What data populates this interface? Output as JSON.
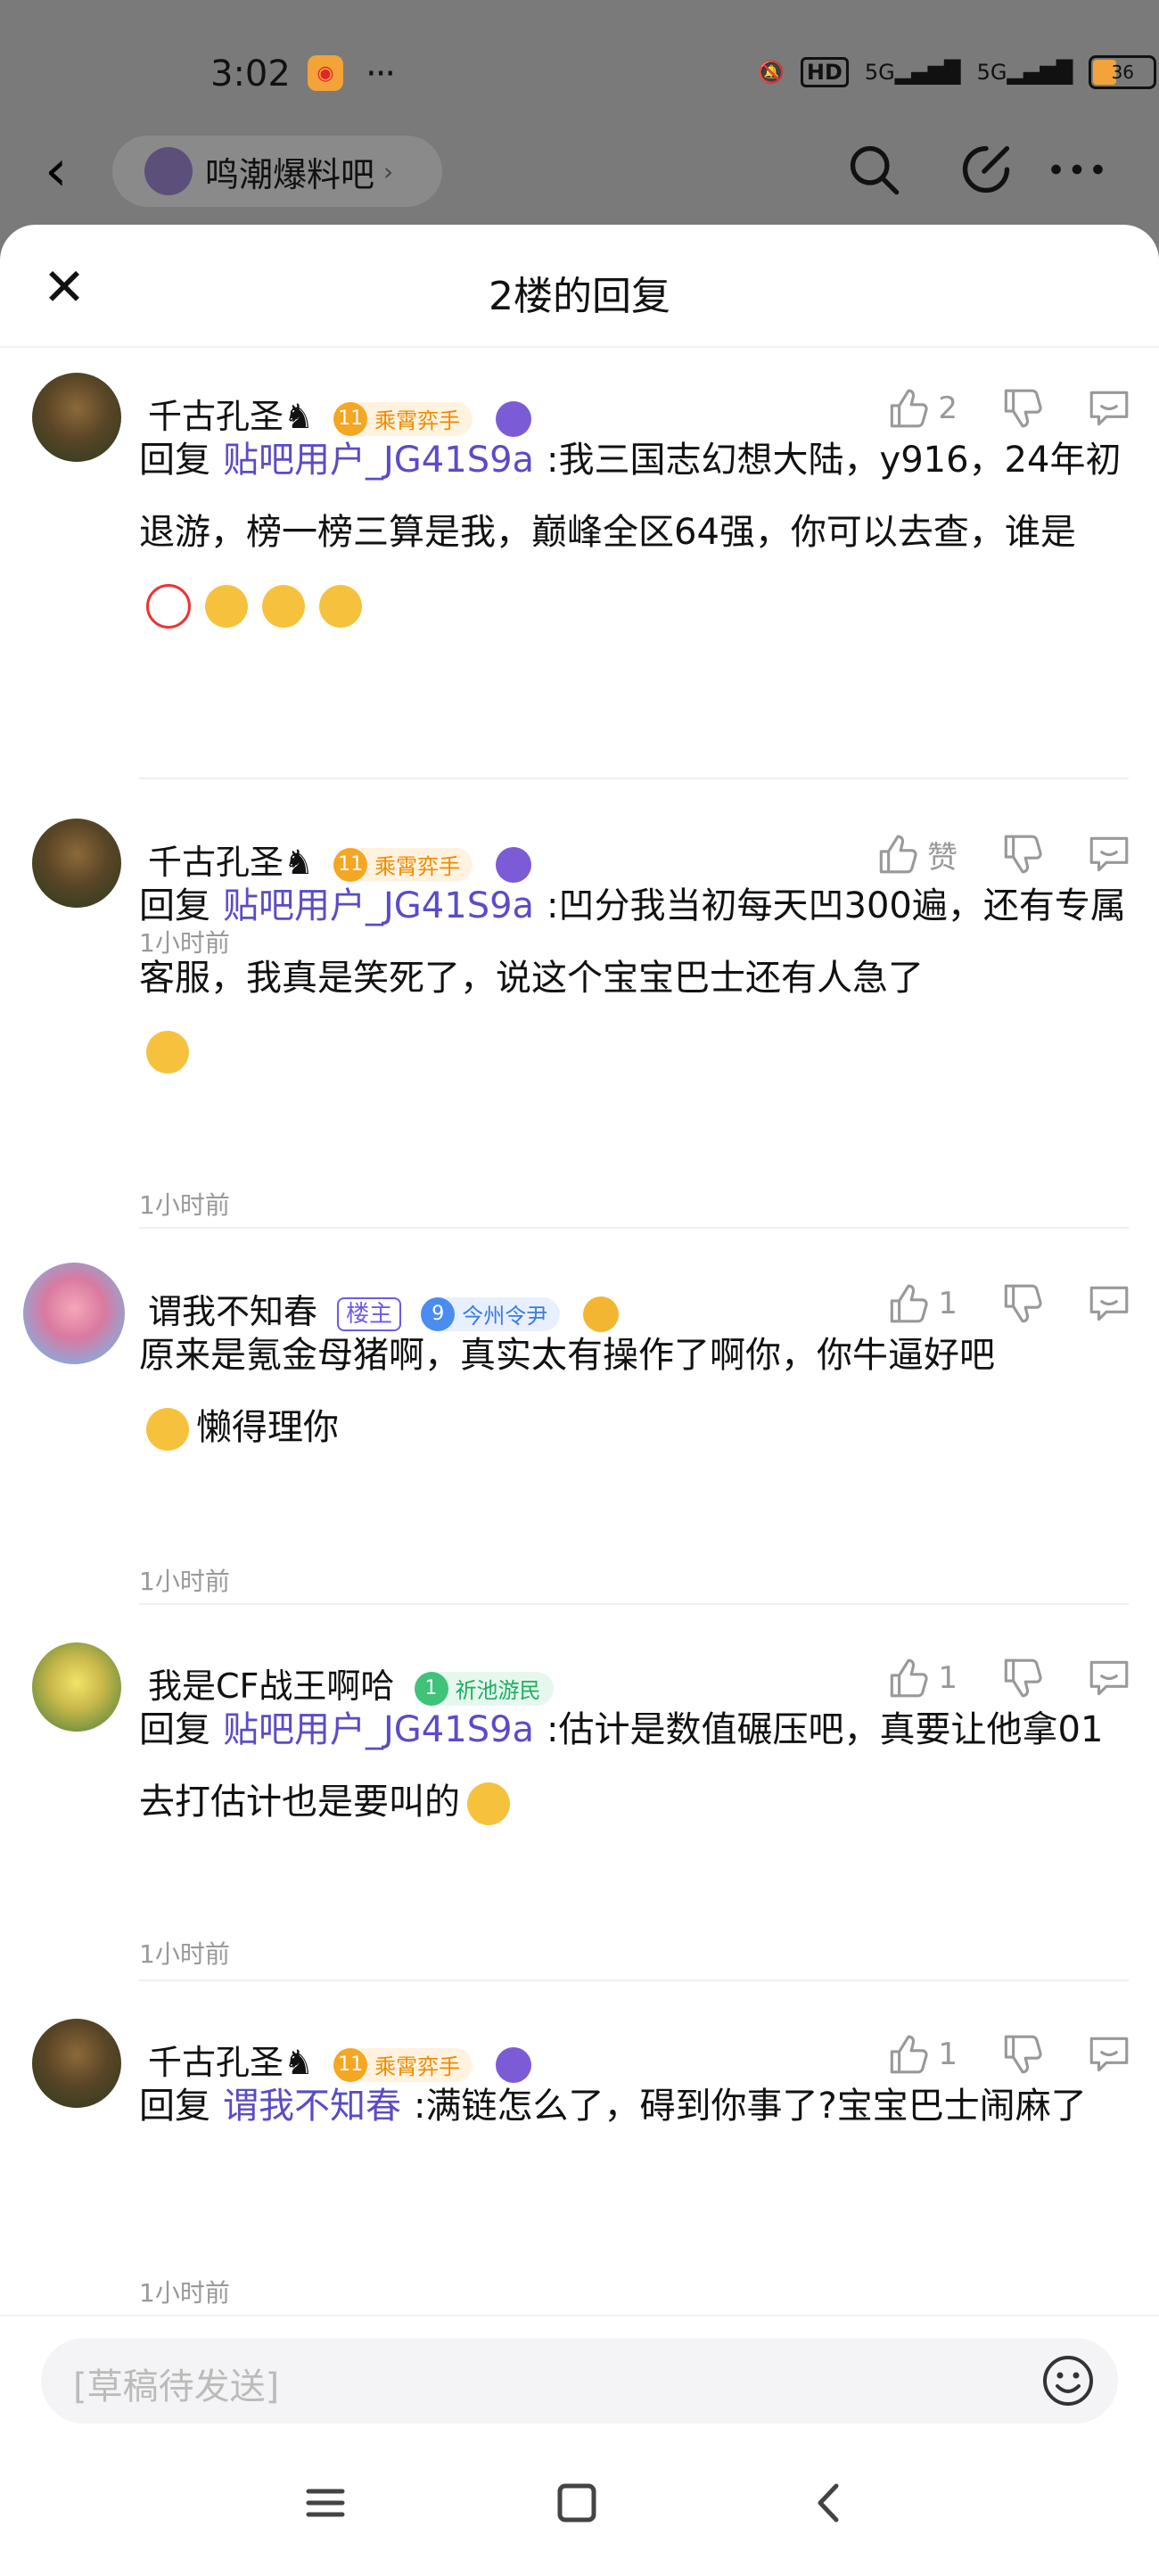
{
  "status": {
    "time": "3:02",
    "dots": "···",
    "net1": "HD",
    "net2": "5G",
    "net3": "5G",
    "battery": "36"
  },
  "header": {
    "forum_name": "鸣潮爆料吧",
    "chevron": "›"
  },
  "sheet": {
    "title": "2楼的回复"
  },
  "comments": [
    {
      "user": "千古孔圣♞",
      "level": "11",
      "title": "乘霄弈手",
      "likes": "2",
      "reply_label": "回复",
      "mention": "贴吧用户_JG41S9a",
      "text": ":我三国志幻想大陆，y916，24年初退游，榜一榜三算是我，巅峰全区64强，你可以去查，谁是",
      "time": "1小时前"
    },
    {
      "user": "千古孔圣♞",
      "level": "11",
      "title": "乘霄弈手",
      "likes": "赞",
      "reply_label": "回复",
      "mention": "贴吧用户_JG41S9a",
      "text": ":凹分我当初每天凹300遍，还有专属客服，我真是笑死了，说这个宝宝巴士还有人急了",
      "time": "1小时前"
    },
    {
      "user": "谓我不知春",
      "owner": "楼主",
      "level": "9",
      "title": "今州令尹",
      "likes": "1",
      "text": "原来是氪金母猪啊，真实太有操作了啊你，你牛逼好吧",
      "text2": "懒得理你",
      "time": "1小时前"
    },
    {
      "user": "我是CF战王啊哈",
      "level": "1",
      "title": "祈池游民",
      "likes": "1",
      "reply_label": "回复",
      "mention": "贴吧用户_JG41S9a",
      "text": ":估计是数值碾压吧，真要让他拿01去打估计也是要叫的",
      "time": "1小时前"
    },
    {
      "user": "千古孔圣♞",
      "level": "11",
      "title": "乘霄弈手",
      "likes": "1",
      "reply_label": "回复",
      "mention": "谓我不知春",
      "text": ":满链怎么了，碍到你事了?宝宝巴士闹麻了",
      "time": "1小时前"
    }
  ],
  "input": {
    "placeholder": "[草稿待发送]"
  },
  "colors": {
    "mention": "#5a4cc7",
    "gold_badge": "#f5a623",
    "blue_badge": "#4a8cf0",
    "green_badge": "#3fc27a",
    "owner": "#6b5ce7"
  }
}
